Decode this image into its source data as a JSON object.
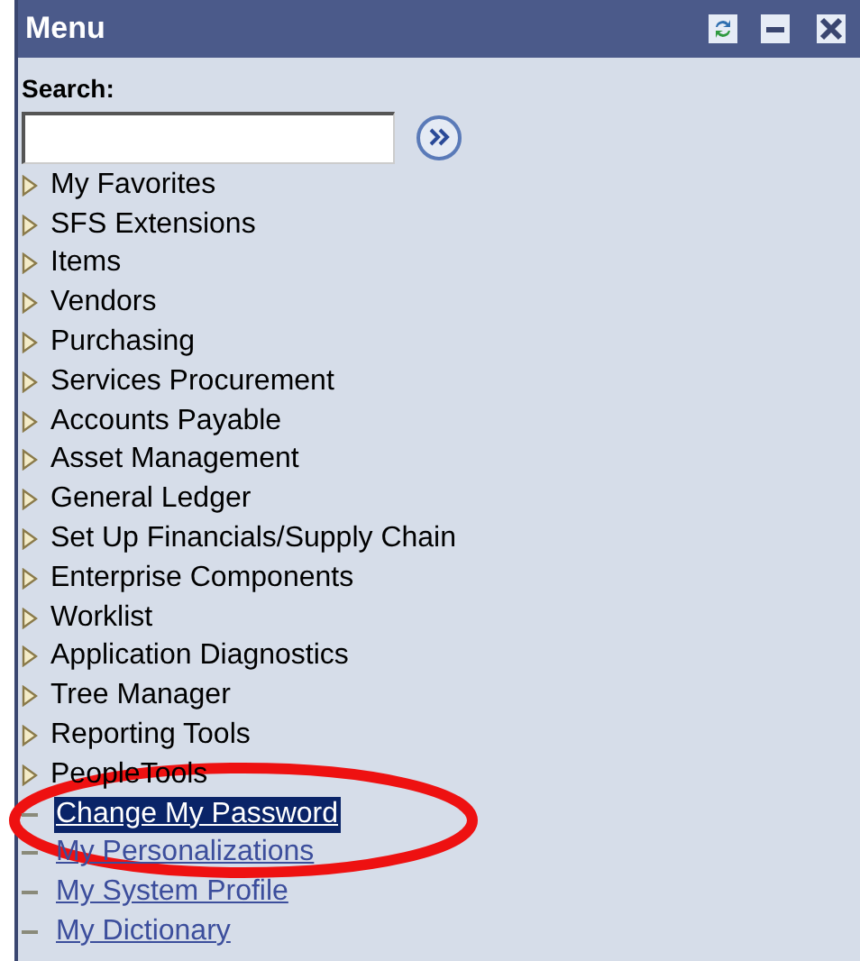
{
  "window": {
    "title": "Menu"
  },
  "search": {
    "label": "Search:"
  },
  "items": [
    {
      "kind": "folder",
      "label": "My Favorites",
      "selected": false
    },
    {
      "kind": "folder",
      "label": "SFS Extensions",
      "selected": false
    },
    {
      "kind": "folder",
      "label": "Items",
      "selected": false
    },
    {
      "kind": "folder",
      "label": "Vendors",
      "selected": false
    },
    {
      "kind": "folder",
      "label": "Purchasing",
      "selected": false
    },
    {
      "kind": "folder",
      "label": "Services Procurement",
      "selected": false
    },
    {
      "kind": "folder",
      "label": "Accounts Payable",
      "selected": false
    },
    {
      "kind": "folder",
      "label": "Asset Management",
      "selected": false
    },
    {
      "kind": "folder",
      "label": "General Ledger",
      "selected": false
    },
    {
      "kind": "folder",
      "label": "Set Up Financials/Supply Chain",
      "selected": false
    },
    {
      "kind": "folder",
      "label": "Enterprise Components",
      "selected": false
    },
    {
      "kind": "folder",
      "label": "Worklist",
      "selected": false
    },
    {
      "kind": "folder",
      "label": "Application Diagnostics",
      "selected": false
    },
    {
      "kind": "folder",
      "label": "Tree Manager",
      "selected": false
    },
    {
      "kind": "folder",
      "label": "Reporting Tools",
      "selected": false
    },
    {
      "kind": "folder",
      "label": "PeopleTools",
      "selected": false
    },
    {
      "kind": "link",
      "label": "Change My Password",
      "selected": true
    },
    {
      "kind": "link",
      "label": "My Personalizations",
      "selected": false
    },
    {
      "kind": "link",
      "label": "My System Profile",
      "selected": false
    },
    {
      "kind": "link",
      "label": "My Dictionary",
      "selected": false
    }
  ]
}
